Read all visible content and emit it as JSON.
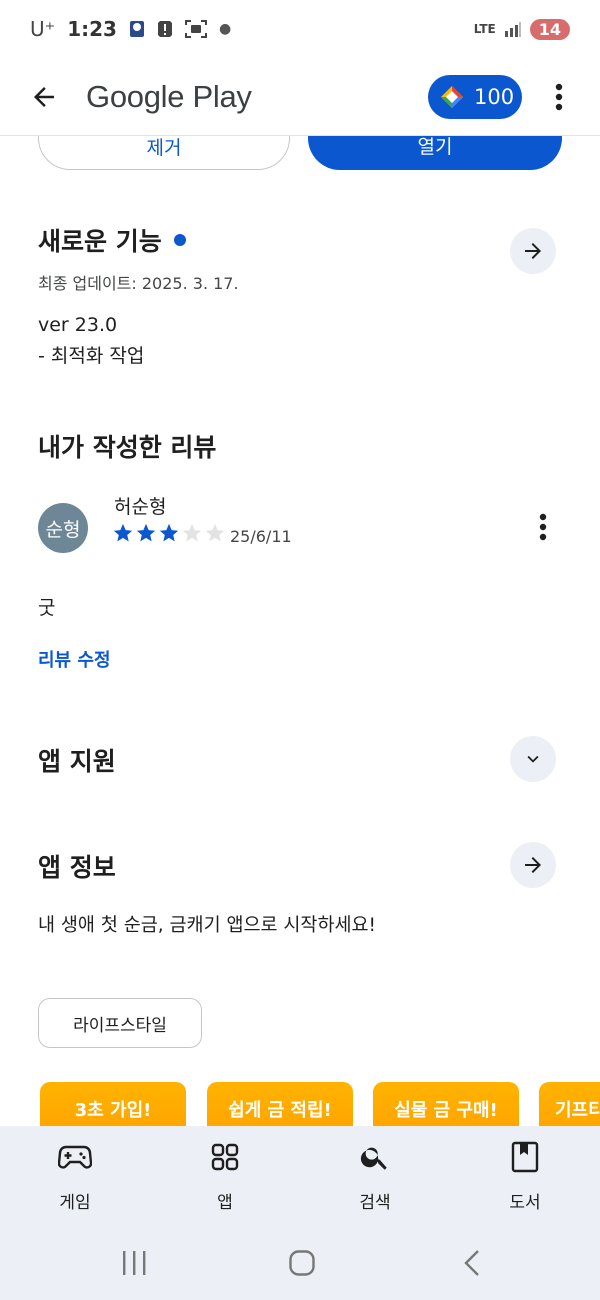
{
  "status_bar": {
    "carrier": "U⁺",
    "time": "1:23",
    "network": "LTE",
    "battery": "14"
  },
  "app_bar": {
    "title": "Google Play",
    "points": "100"
  },
  "top_buttons": {
    "remove": "제거",
    "open": "열기"
  },
  "whats_new": {
    "title": "새로운 기능",
    "updated": "최종 업데이트: 2025. 3. 17.",
    "line1": "ver 23.0",
    "line2": "- 최적화 작업"
  },
  "my_review": {
    "title": "내가 작성한 리뷰",
    "avatar": "순형",
    "name": "허순형",
    "rating": 3,
    "max_rating": 5,
    "date": "25/6/11",
    "body": "굿",
    "edit_label": "리뷰 수정"
  },
  "app_support": {
    "title": "앱 지원"
  },
  "app_info": {
    "title": "앱 정보",
    "description": "내 생애 첫 순금, 금캐기 앱으로 시작하세요!",
    "category": "라이프스타일"
  },
  "screenshots": [
    "3초 가입!",
    "쉽게 금 적립!",
    "실물 금 구매!",
    "기프티"
  ],
  "bottom_nav": [
    {
      "label": "게임",
      "icon": "gamepad-icon"
    },
    {
      "label": "앱",
      "icon": "apps-grid-icon"
    },
    {
      "label": "검색",
      "icon": "search-icon"
    },
    {
      "label": "도서",
      "icon": "book-icon"
    }
  ],
  "colors": {
    "accent": "#0b57d0",
    "surface": "#eceff6",
    "star_on": "#0b57d0",
    "star_off": "#e3e3e3"
  }
}
